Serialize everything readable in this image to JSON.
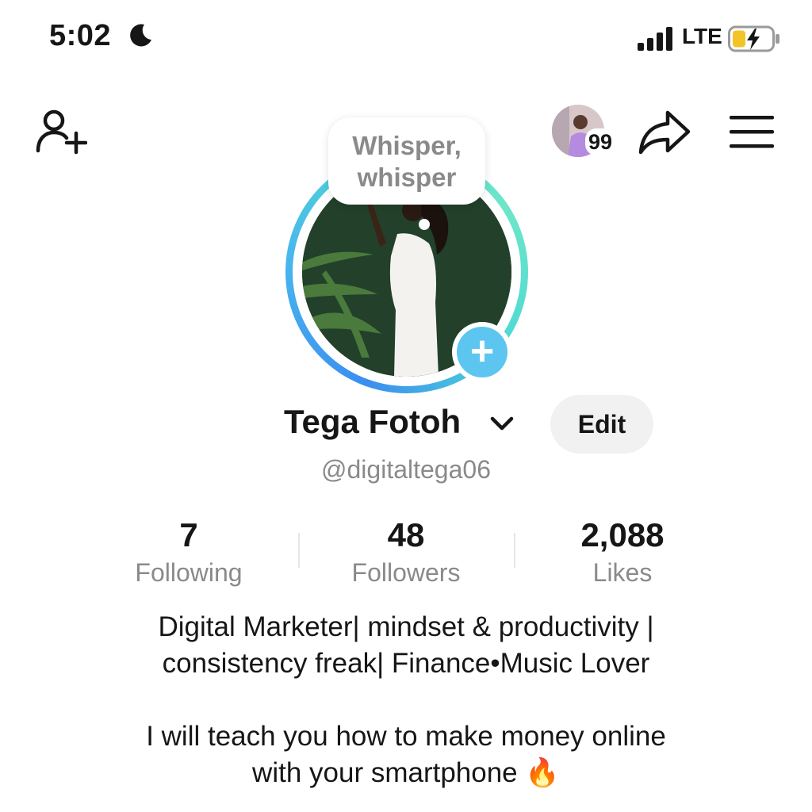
{
  "status_bar": {
    "time": "5:02",
    "network": "LTE"
  },
  "header": {
    "notification_count": "99"
  },
  "avatar": {
    "note": [
      "Whisper,",
      "whisper"
    ]
  },
  "profile": {
    "display_name": "Tega Fotoh",
    "edit_label": "Edit",
    "username": "@digitaltega06"
  },
  "stats": [
    {
      "value": "7",
      "label": "Following"
    },
    {
      "value": "48",
      "label": "Followers"
    },
    {
      "value": "2,088",
      "label": "Likes"
    }
  ],
  "bio": {
    "lines": [
      "Digital Marketer| mindset & productivity |",
      "consistency freak| Finance•Music Lover",
      "I will teach you how to make money online",
      "with your smartphone 🔥"
    ]
  },
  "colors": {
    "accent_blue": "#5cc6f0",
    "ring_start": "#3a8ef0",
    "ring_end": "#6ee6c8",
    "muted_text": "#8a8a8a"
  }
}
